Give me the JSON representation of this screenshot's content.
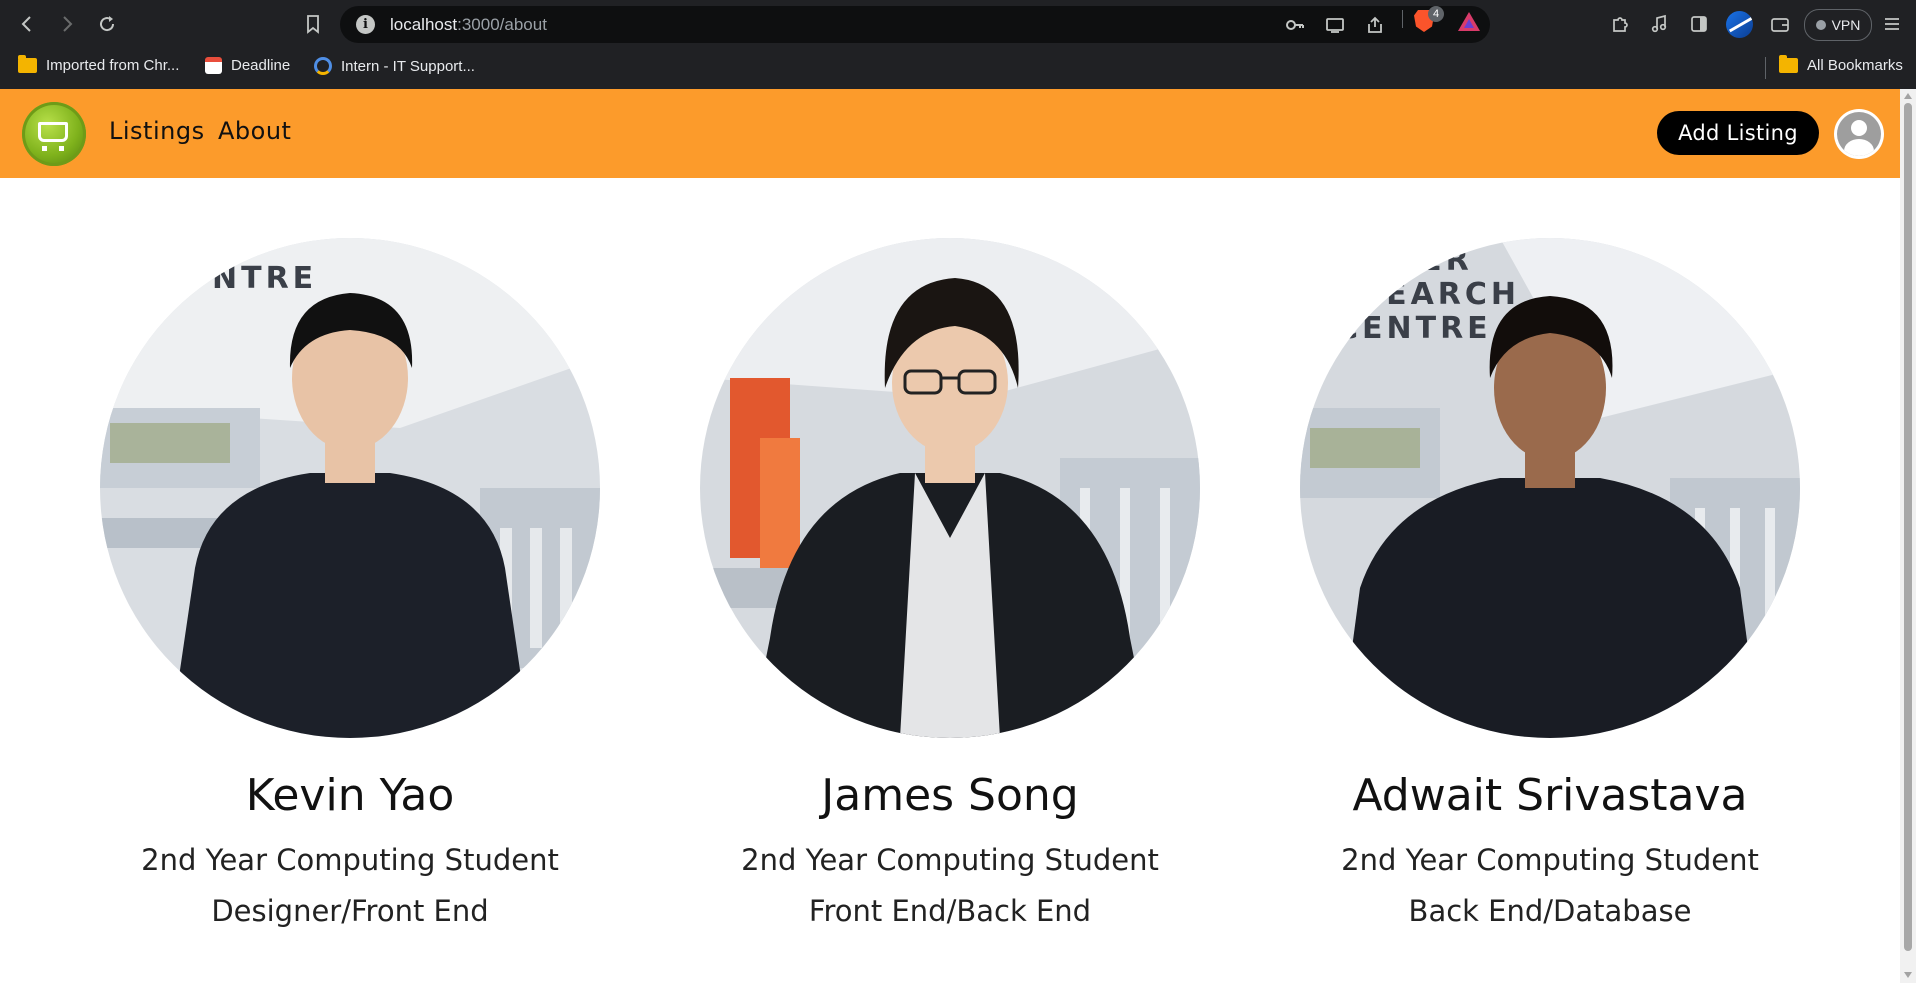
{
  "browser": {
    "url_host": "localhost",
    "url_path": ":3000/about",
    "brave_badge": "4",
    "vpn_label": "VPN",
    "bookmarks": [
      {
        "label": "Imported from Chr...",
        "icon": "folder-icon"
      },
      {
        "label": "Deadline",
        "icon": "calendar-icon"
      },
      {
        "label": "Intern - IT Support...",
        "icon": "intern-site-icon"
      }
    ],
    "all_bookmarks": "All Bookmarks"
  },
  "navbar": {
    "links": [
      "Listings",
      "About"
    ],
    "add_listing": "Add Listing"
  },
  "members": [
    {
      "name": "Kevin Yao",
      "year": "2nd Year Computing Student",
      "role": "Designer/Front End",
      "background_text": "CH\nNTRE",
      "shirt_color": "#1c2029",
      "skin_color": "#e8c3a6",
      "hair_color": "#111111"
    },
    {
      "name": "James Song",
      "year": "2nd Year Computing Student",
      "role": "Front End/Back End",
      "background_text": "",
      "shirt_color": "#1a1d22",
      "skin_color": "#ecc9ad",
      "hair_color": "#1a1512"
    },
    {
      "name": "Adwait Srivastava",
      "year": "2nd Year Computing Student",
      "role": "Back End/Database",
      "background_text": "WATER\nESEARCH\nCENTRE",
      "shirt_color": "#191c24",
      "skin_color": "#9a6a4c",
      "hair_color": "#120d0b"
    }
  ],
  "colors": {
    "navbar": "#fc9b2b",
    "button": "#000000",
    "chrome": "#202124"
  }
}
